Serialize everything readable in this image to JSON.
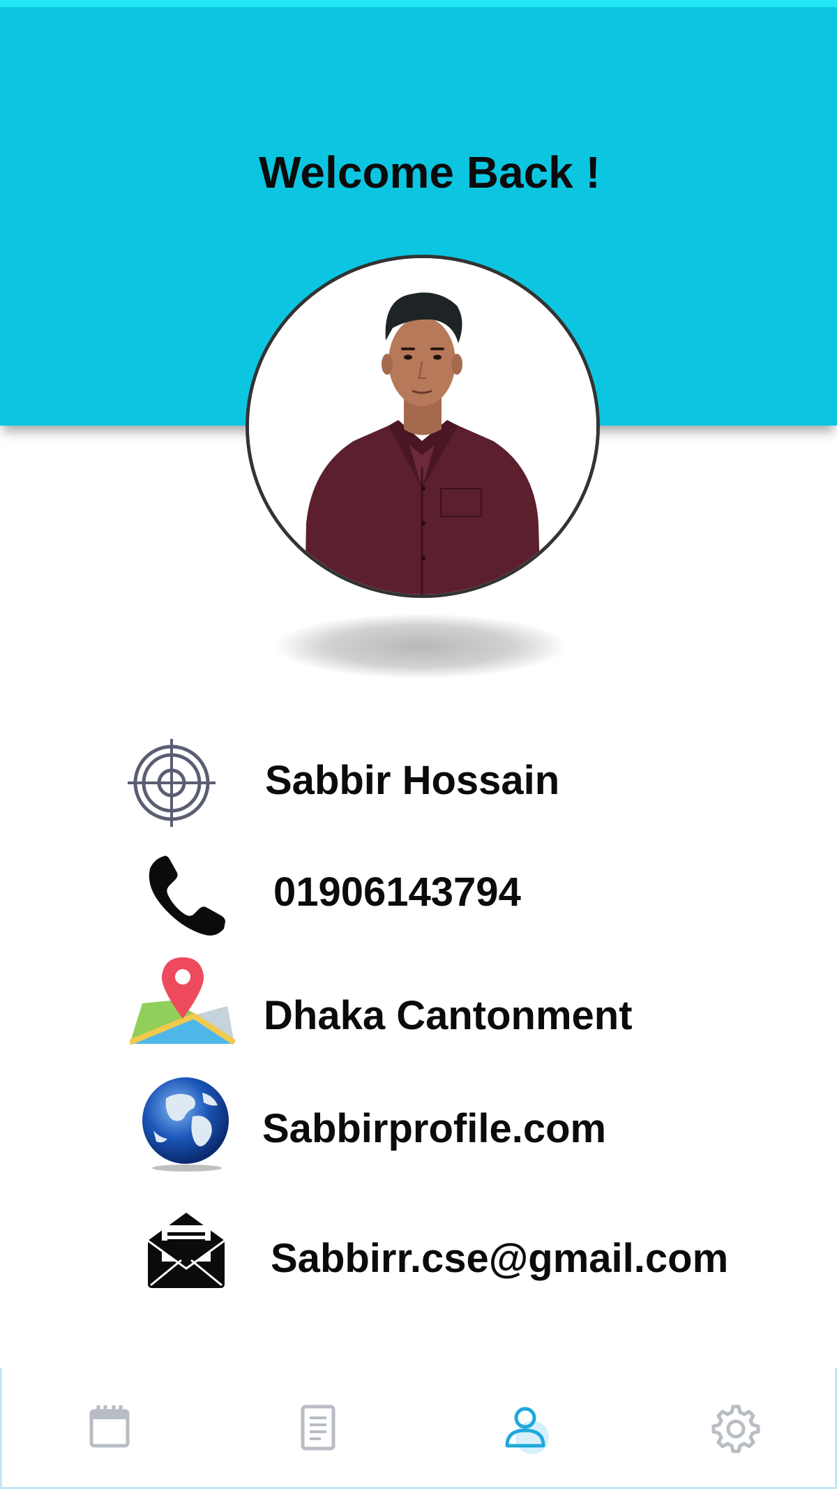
{
  "header": {
    "welcome_text": "Welcome Back !",
    "background_color": "#0cc6e1"
  },
  "profile": {
    "avatar": "profile-photo",
    "name": "Sabbir Hossain",
    "phone": "01906143794",
    "location": "Dhaka Cantonment",
    "website": "Sabbirprofile.com",
    "email": "Sabbirr.cse@gmail.com"
  },
  "icons": {
    "name": "target-icon",
    "phone": "phone-icon",
    "location": "map-pin-icon",
    "website": "globe-icon",
    "email": "envelope-icon"
  },
  "bottom_nav": {
    "items": [
      {
        "icon": "calendar-icon",
        "active": false
      },
      {
        "icon": "document-icon",
        "active": false
      },
      {
        "icon": "user-icon",
        "active": true
      },
      {
        "icon": "gear-icon",
        "active": false
      }
    ],
    "active_color": "#1fa8dc",
    "inactive_color": "#b8bdc4"
  }
}
